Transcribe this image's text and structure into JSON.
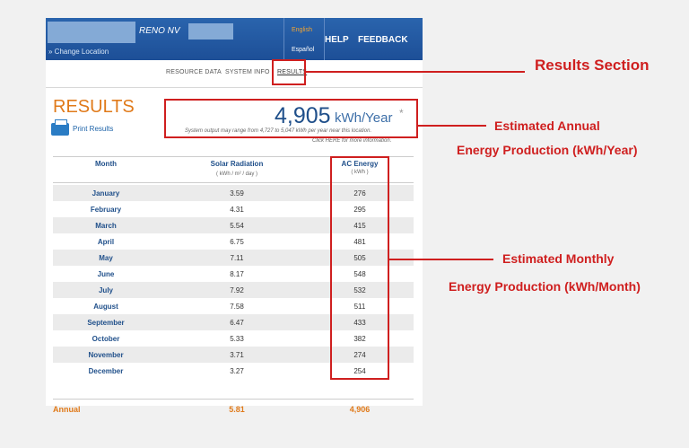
{
  "header": {
    "location": "RENO NV",
    "change_location": "» Change Location",
    "language_en": "English",
    "language_es": "Español",
    "help": "HELP",
    "feedback": "FEEDBACK"
  },
  "tabs": [
    {
      "label": "RESOURCE DATA"
    },
    {
      "label": "SYSTEM INFO"
    },
    {
      "label": "RESULTS"
    }
  ],
  "results": {
    "title": "RESULTS",
    "print_label": "Print Results",
    "annual_output": "4,905",
    "annual_unit": "kWh/Year",
    "annual_star": "*",
    "range_note": "System output may range from 4,727 to 5,047 kWh per year near this location.",
    "click_note": "Click HERE for more information."
  },
  "table": {
    "headers": {
      "month": "Month",
      "solar": "Solar Radiation",
      "solar_unit": "( kWh / m² / day )",
      "ac": "AC Energy",
      "ac_unit": "( kWh )"
    },
    "rows": [
      {
        "month": "January",
        "solar": "3.59",
        "ac": "276"
      },
      {
        "month": "February",
        "solar": "4.31",
        "ac": "295"
      },
      {
        "month": "March",
        "solar": "5.54",
        "ac": "415"
      },
      {
        "month": "April",
        "solar": "6.75",
        "ac": "481"
      },
      {
        "month": "May",
        "solar": "7.11",
        "ac": "505"
      },
      {
        "month": "June",
        "solar": "8.17",
        "ac": "548"
      },
      {
        "month": "July",
        "solar": "7.92",
        "ac": "532"
      },
      {
        "month": "August",
        "solar": "7.58",
        "ac": "511"
      },
      {
        "month": "September",
        "solar": "6.47",
        "ac": "433"
      },
      {
        "month": "October",
        "solar": "5.33",
        "ac": "382"
      },
      {
        "month": "November",
        "solar": "3.71",
        "ac": "274"
      },
      {
        "month": "December",
        "solar": "3.27",
        "ac": "254"
      }
    ],
    "annual": {
      "label": "Annual",
      "solar": "5.81",
      "ac": "4,906"
    }
  },
  "annotations": {
    "results_section": "Results Section",
    "annual_line1": "Estimated Annual",
    "annual_line2": "Energy Production (kWh/Year)",
    "monthly_line1": "Estimated Monthly",
    "monthly_line2": "Energy Production (kWh/Month)"
  },
  "colors": {
    "header_blue": "#1d4f97",
    "orange": "#e07a1a",
    "annotation_red": "#cf1f1f"
  }
}
